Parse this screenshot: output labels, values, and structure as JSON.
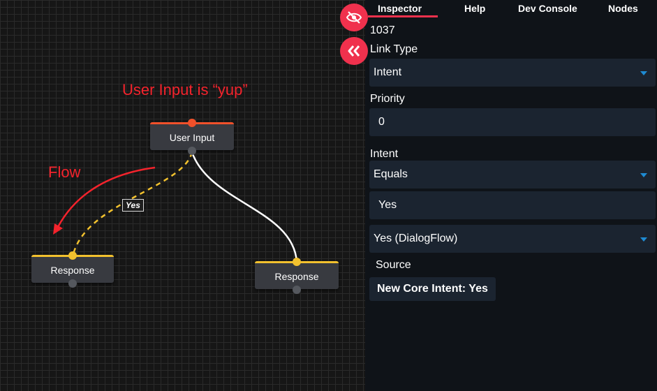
{
  "canvas": {
    "annotation_title": "User Input is “yup”",
    "annotation_flow": "Flow",
    "nodes": {
      "user_input": "User Input",
      "response_left": "Response",
      "response_right": "Response"
    },
    "link_label": "Yes",
    "colors": {
      "annotation": "#f4232c",
      "dashed_link": "#f2c12e",
      "solid_link": "#ffffff"
    }
  },
  "floating_buttons": {
    "hide": "eye-slash-icon",
    "collapse": "double-chevron-left-icon",
    "color": "#f0314d"
  },
  "tabs": [
    {
      "label": "Inspector",
      "active": true
    },
    {
      "label": "Help"
    },
    {
      "label": "Dev Console"
    },
    {
      "label": "Nodes"
    }
  ],
  "inspector": {
    "id": "1037",
    "link_type_label": "Link Type",
    "link_type_value": "Intent",
    "priority_label": "Priority",
    "priority_value": "0",
    "intent_label": "Intent",
    "intent_operator": "Equals",
    "intent_value": "Yes",
    "intent_source_select": "Yes (DialogFlow)",
    "source_label": "Source",
    "source_tag": "New Core Intent: Yes"
  }
}
